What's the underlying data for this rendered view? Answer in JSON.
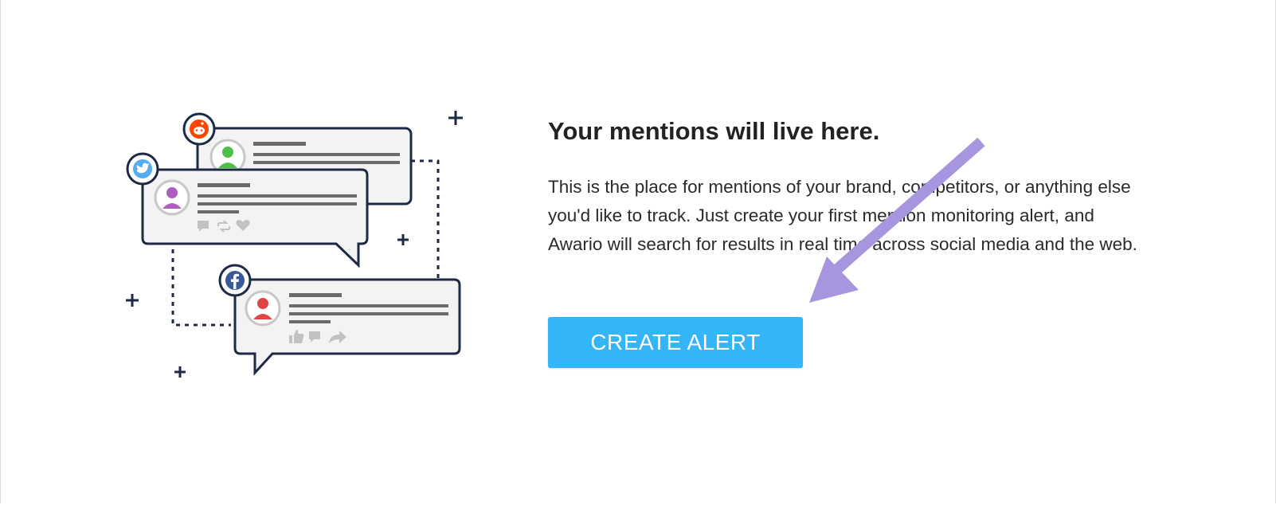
{
  "empty_state": {
    "title": "Your mentions will live here.",
    "description": "This is the place for mentions of your brand, competitors, or anything else you'd like to track. Just create your first mention monitoring alert, and Awario will search for results in real time across social media and the web.",
    "cta_label": "CREATE ALERT"
  },
  "illustration": {
    "networks": [
      "reddit-icon",
      "twitter-icon",
      "facebook-icon"
    ],
    "action_icons": [
      "comment-icon",
      "retweet-icon",
      "heart-icon",
      "like-icon",
      "share-icon"
    ]
  },
  "colors": {
    "button": "#33b5f7",
    "arrow": "#a895e0",
    "outline": "#1e2a44",
    "reddit": "#ff4500",
    "twitter": "#55acee",
    "facebook": "#3b5998"
  }
}
